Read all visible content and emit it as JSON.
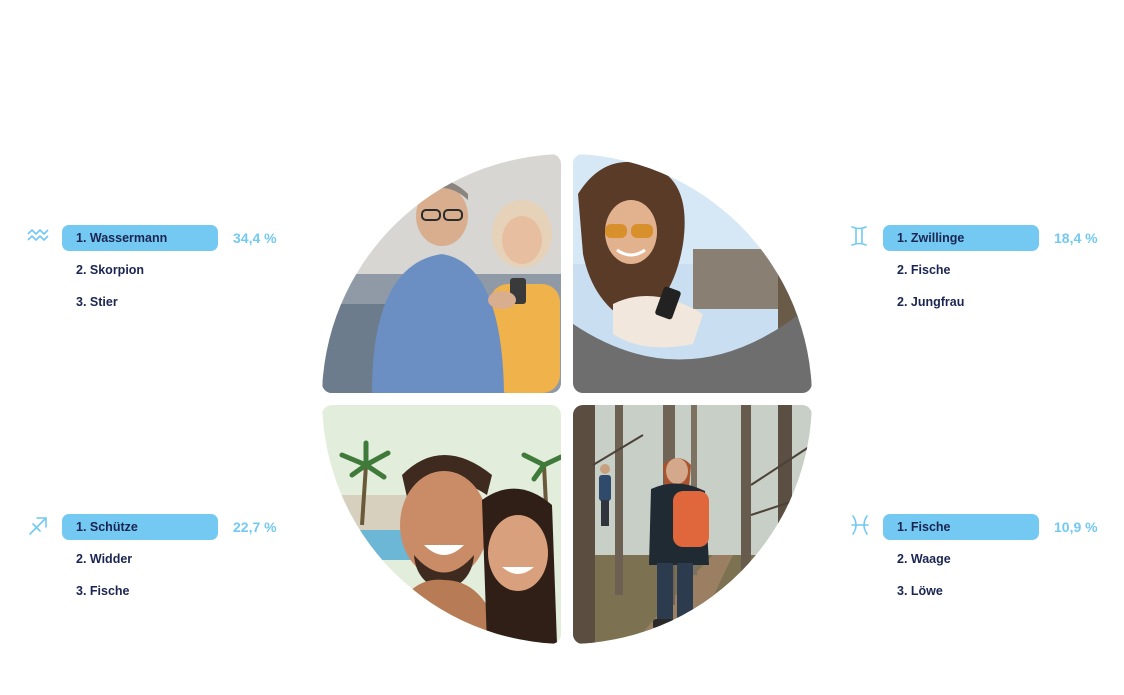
{
  "colors": {
    "accent": "#73c9f2",
    "text_dark": "#1b2552"
  },
  "blocks": {
    "aquarius": {
      "icon": "aquarius-icon",
      "items": [
        "1. Wassermann",
        "2. Skorpion",
        "3. Stier"
      ],
      "percent": "34,4 %"
    },
    "gemini": {
      "icon": "gemini-icon",
      "items": [
        "1. Zwillinge",
        "2. Fische",
        "2. Jungfrau"
      ],
      "percent": "18,4 %"
    },
    "sagittarius": {
      "icon": "sagittarius-icon",
      "items": [
        "1. Schütze",
        "2. Widder",
        "3. Fische"
      ],
      "percent": "22,7 %"
    },
    "pisces": {
      "icon": "pisces-icon",
      "items": [
        "1. Fische",
        "2. Waage",
        "3. Löwe"
      ],
      "percent": "10,9 %"
    }
  },
  "photos": {
    "top_left": "couple-with-smartphone-photo",
    "top_right": "woman-in-hammock-photo",
    "bottom_left": "couple-selfie-photo",
    "bottom_right": "hikers-in-forest-photo"
  }
}
